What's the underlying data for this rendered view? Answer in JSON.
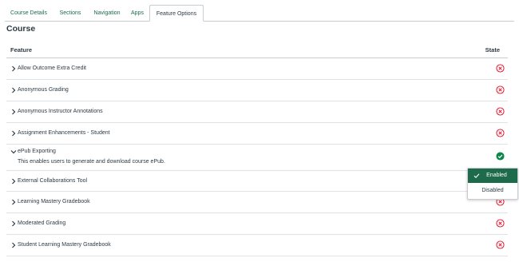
{
  "tabs": [
    "Course Details",
    "Sections",
    "Navigation",
    "Apps",
    "Feature Options"
  ],
  "page_title": "Course",
  "table": {
    "col_feature": "Feature",
    "col_state": "State"
  },
  "features": [
    {
      "label": "Allow Outcome Extra Credit",
      "state": "disabled",
      "expanded": false
    },
    {
      "label": "Anonymous Grading",
      "state": "disabled",
      "expanded": false
    },
    {
      "label": "Anonymous Instructor Annotations",
      "state": "disabled",
      "expanded": false
    },
    {
      "label": "Assignment Enhancements - Student",
      "state": "disabled",
      "expanded": false
    },
    {
      "label": "ePub Exporting",
      "state": "enabled",
      "expanded": true,
      "description": "This enables users to generate and download course ePub."
    },
    {
      "label": "External Collaborations Tool",
      "state": "menu-open",
      "expanded": false
    },
    {
      "label": "Learning Mastery Gradebook",
      "state": "disabled",
      "expanded": false
    },
    {
      "label": "Moderated Grading",
      "state": "disabled",
      "expanded": false
    },
    {
      "label": "Student Learning Mastery Gradebook",
      "state": "disabled",
      "expanded": false
    }
  ],
  "state_menu": {
    "options": [
      "Enabled",
      "Disabled"
    ],
    "selected": "Enabled"
  },
  "colors": {
    "accent": "#1d6b4a",
    "disabled_red": "#e0061f",
    "enabled_green": "#0b874b"
  }
}
